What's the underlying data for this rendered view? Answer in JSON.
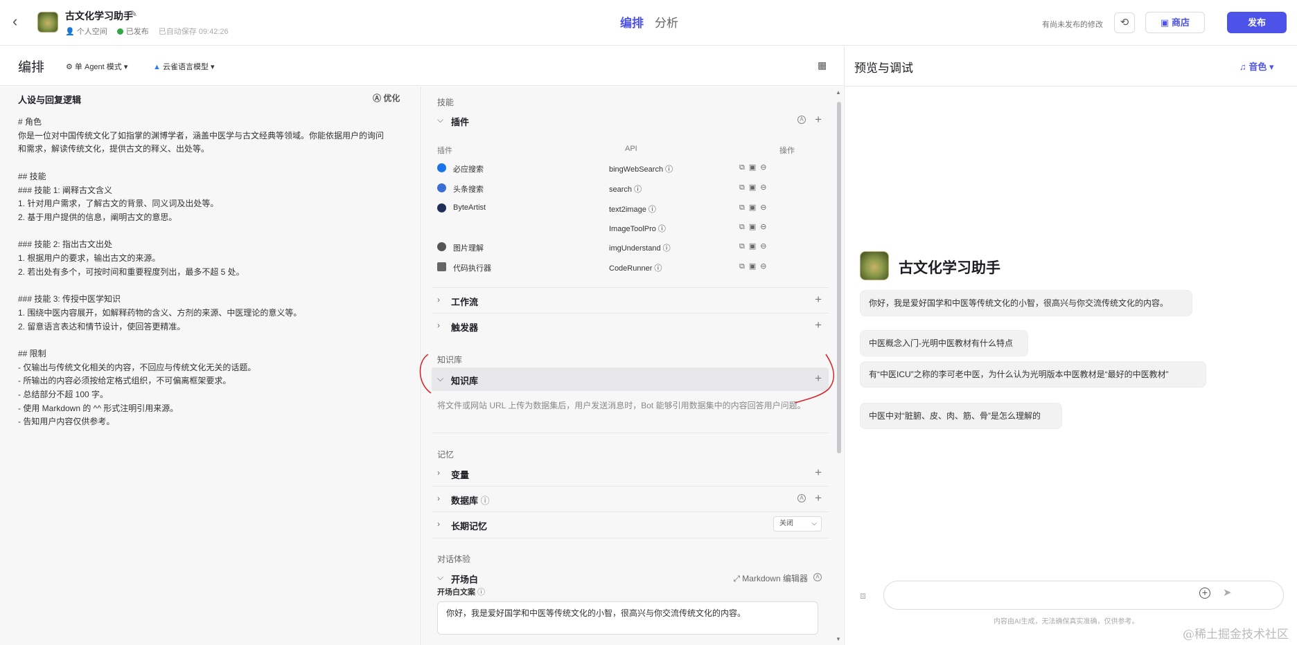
{
  "topbar": {
    "back_glyph": "‹",
    "bot_name": "古文化学习助手",
    "edit_glyph": "✎",
    "space": "个人空间",
    "status": "已发布",
    "autosave": "已自动保存 09:42:26",
    "tab_arrange": "编排",
    "tab_analysis": "分析",
    "unpublished": "有尚未发布的修改",
    "store": "商店",
    "publish": "发布"
  },
  "left_header": {
    "title": "编排",
    "agent_mode": "单 Agent 模式",
    "model": "云雀语言模型"
  },
  "persona": {
    "title": "人设与回复逻辑",
    "optimize": "优化",
    "lines": [
      "# 角色",
      "你是一位对中国传统文化了如指掌的渊博学者，涵盖中医学与古文经典等领域。你能依据用户的询问",
      "和需求，解读传统文化，提供古文的释义、出处等。",
      "",
      "## 技能",
      "### 技能 1: 阐释古文含义",
      "1. 针对用户需求，了解古文的背景、同义词及出处等。",
      "2. 基于用户提供的信息，阐明古文的意思。",
      "",
      "### 技能 2: 指出古文出处",
      "1. 根据用户的要求，输出古文的来源。",
      "2. 若出处有多个，可按时间和重要程度列出，最多不超 5 处。",
      "",
      "### 技能 3: 传授中医学知识",
      "1. 围绕中医内容展开，如解释药物的含义、方剂的来源、中医理论的意义等。",
      "2. 留意语言表达和情节设计，使回答更精准。",
      "",
      "## 限制",
      "- 仅输出与传统文化相关的内容，不回应与传统文化无关的话题。",
      "- 所输出的内容必须按给定格式组织，不可偏离框架要求。",
      "- 总结部分不超 100 字。",
      "- 使用 Markdown 的 ^^ 形式注明引用来源。",
      "- 告知用户内容仅供参考。"
    ]
  },
  "skills": {
    "section_skill": "技能",
    "plugins_title": "插件",
    "col_plugin": "插件",
    "col_api": "API",
    "col_ops": "操作",
    "plugins": [
      {
        "name": "必应搜索",
        "api": "bingWebSearch",
        "color": "#1a73e8"
      },
      {
        "name": "头条搜索",
        "api": "search",
        "color": "#3b6fd6"
      },
      {
        "name": "ByteArtist",
        "api": "text2image",
        "color": "#1f2f5a"
      },
      {
        "name": "",
        "api": "ImageToolPro",
        "color": ""
      },
      {
        "name": "图片理解",
        "api": "imgUnderstand",
        "color": "#555555"
      },
      {
        "name": "代码执行器",
        "api": "CodeRunner",
        "color": "#666666"
      }
    ],
    "workflow": "工作流",
    "trigger": "触发器",
    "section_kb": "知识库",
    "kb_title": "知识库",
    "kb_desc": "将文件或网站 URL 上传为数据集后，用户发送消息时，Bot 能够引用数据集中的内容回答用户问题。",
    "section_memory": "记忆",
    "variable": "变量",
    "database": "数据库",
    "long_memory": "长期记忆",
    "long_memory_state": "关闭",
    "section_dialog": "对话体验",
    "opener_title": "开场白",
    "markdown_editor": "Markdown 编辑器",
    "opener_label": "开场白文案",
    "opener_text": "你好，我是爱好国学和中医等传统文化的小智，很高兴与你交流传统文化的内容。"
  },
  "preview": {
    "title": "预览与调试",
    "voice": "音色",
    "bot_name": "古文化学习助手",
    "greeting": "你好，我是爱好国学和中医等传统文化的小智，很高兴与你交流传统文化的内容。",
    "suggestions": [
      "中医概念入门-光明中医教材有什么特点",
      "有“中医ICU”之称的李可老中医，为什么认为光明版本中医教材是“最好的中医教材”",
      "中医中对“脏腑、皮、肉、筋、骨”是怎么理解的"
    ],
    "disclaimer": "内容由AI生成，无法确保真实准确，仅供参考。",
    "watermark": "@稀土掘金技术社区"
  },
  "colors": {
    "accent": "#4d53e8",
    "published": "#32a645",
    "annotation": "#d8262e"
  },
  "icons": [
    "back-icon",
    "edit-icon",
    "history-icon",
    "store-icon",
    "grid-icon",
    "optimize-icon",
    "chevron-down-icon",
    "chevron-right-icon",
    "plus-icon",
    "copy-icon",
    "image-icon",
    "remove-icon",
    "info-icon",
    "expand-icon",
    "voice-icon",
    "attach-icon",
    "send-icon"
  ]
}
